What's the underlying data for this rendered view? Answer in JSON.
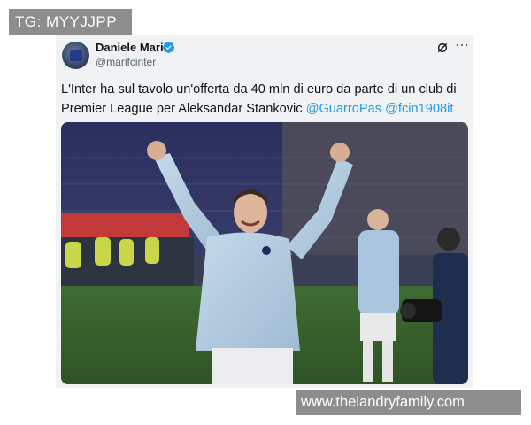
{
  "overlay": {
    "tg_label": "TG: MYYJJPP",
    "watermark": "www.thelandryfamily.com"
  },
  "tweet": {
    "author": {
      "display_name": "Daniele Mari",
      "handle": "@marifcinter",
      "verified": true
    },
    "text_line1": "L'Inter ha sul tavolo un'offerta da 40 mln di euro da parte di un club di",
    "text_line2_plain": "Premier League per Aleksandar Stankovic ",
    "mentions": [
      "@GuarroPas",
      "@fcin1908it"
    ],
    "header_icons": [
      "grok-icon",
      "more-icon"
    ],
    "image": {
      "alt_icon": "photo-player-celebrating"
    }
  },
  "colors": {
    "card_bg": "#f1f2f3",
    "mention": "#1d9bf0",
    "verified": "#1d9bf0",
    "overlay_bg": "#8d8d8d"
  }
}
